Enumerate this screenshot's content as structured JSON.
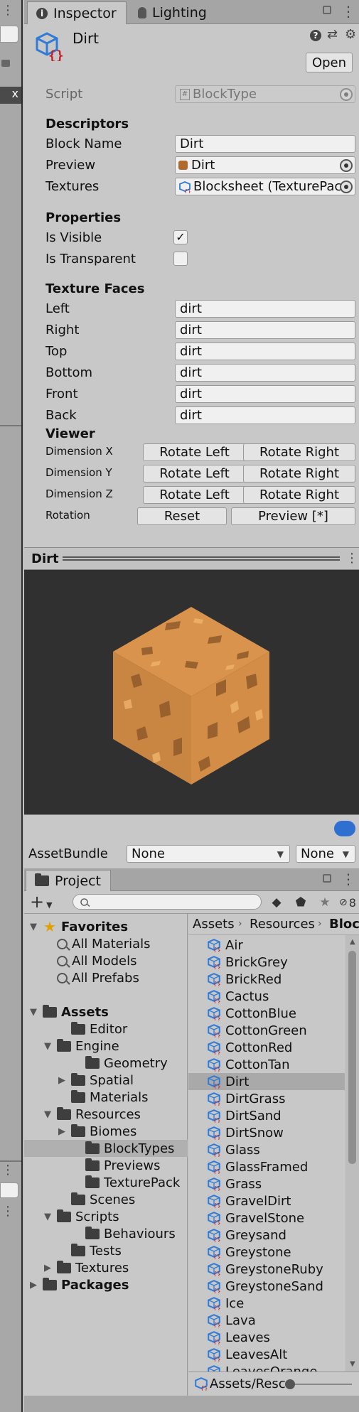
{
  "inspector": {
    "tabs": [
      {
        "label": "Inspector",
        "icon": "info-icon"
      },
      {
        "label": "Lighting",
        "icon": "bulb-icon"
      }
    ],
    "object_name": "Dirt",
    "open_label": "Open",
    "script_label": "Script",
    "script_value": "BlockType",
    "descriptors_header": "Descriptors",
    "block_name_label": "Block Name",
    "block_name_value": "Dirt",
    "preview_label": "Preview",
    "preview_value": "Dirt",
    "textures_label": "Textures",
    "textures_value": "Blocksheet (TexturePac",
    "properties_header": "Properties",
    "is_visible_label": "Is Visible",
    "is_visible_checked": true,
    "is_visible_mark": "✓",
    "is_transparent_label": "Is Transparent",
    "is_transparent_checked": false,
    "texture_faces_header": "Texture Faces",
    "faces": [
      {
        "label": "Left",
        "value": "dirt"
      },
      {
        "label": "Right",
        "value": "dirt"
      },
      {
        "label": "Top",
        "value": "dirt"
      },
      {
        "label": "Bottom",
        "value": "dirt"
      },
      {
        "label": "Front",
        "value": "dirt"
      },
      {
        "label": "Back",
        "value": "dirt"
      }
    ],
    "viewer_header": "Viewer",
    "dims": [
      {
        "label": "Dimension X",
        "left": "Rotate Left",
        "right": "Rotate Right"
      },
      {
        "label": "Dimension Y",
        "left": "Rotate Left",
        "right": "Rotate Right"
      },
      {
        "label": "Dimension Z",
        "left": "Rotate Left",
        "right": "Rotate Right"
      }
    ],
    "rotation_label": "Rotation",
    "reset_label": "Reset",
    "preview_btn_label": "Preview [*]"
  },
  "preview_panel": {
    "title": "Dirt",
    "cube_color": "#d08a45",
    "bg_color": "#303030"
  },
  "assetbundle": {
    "label": "AssetBundle",
    "name_value": "None",
    "variant_value": "None"
  },
  "project": {
    "tab_label": "Project",
    "add_label": "+",
    "hidden_count": "8",
    "breadcrumb": [
      "Assets",
      "Resources",
      "Bloc"
    ],
    "footer_path": "Assets/Resc",
    "tree": [
      {
        "label": "Favorites",
        "bold": true,
        "icon": "star-icon",
        "indent": 0,
        "arrow": "open"
      },
      {
        "label": "All Materials",
        "icon": "search-icon",
        "indent": 1
      },
      {
        "label": "All Models",
        "icon": "search-icon",
        "indent": 1
      },
      {
        "label": "All Prefabs",
        "icon": "search-icon",
        "indent": 1
      },
      {
        "label": "",
        "icon": "none",
        "indent": 0
      },
      {
        "label": "Assets",
        "bold": true,
        "icon": "folder-open-icon",
        "indent": 0,
        "arrow": "open"
      },
      {
        "label": "Editor",
        "icon": "folder-icon",
        "indent": 2
      },
      {
        "label": "Engine",
        "icon": "folder-open-icon",
        "indent": 1,
        "arrow": "open"
      },
      {
        "label": "Geometry",
        "icon": "folder-icon",
        "indent": 3
      },
      {
        "label": "Spatial",
        "icon": "folder-icon",
        "indent": 2,
        "arrow": "closed"
      },
      {
        "label": "Materials",
        "icon": "folder-icon",
        "indent": 2
      },
      {
        "label": "Resources",
        "icon": "folder-open-icon",
        "indent": 1,
        "arrow": "open"
      },
      {
        "label": "Biomes",
        "icon": "folder-icon",
        "indent": 2,
        "arrow": "closed"
      },
      {
        "label": "BlockTypes",
        "icon": "folder-icon",
        "indent": 3,
        "selected": true
      },
      {
        "label": "Previews",
        "icon": "folder-icon",
        "indent": 3
      },
      {
        "label": "TexturePack",
        "icon": "folder-icon",
        "indent": 3
      },
      {
        "label": "Scenes",
        "icon": "folder-icon",
        "indent": 2
      },
      {
        "label": "Scripts",
        "icon": "folder-open-icon",
        "indent": 1,
        "arrow": "open"
      },
      {
        "label": "Behaviours",
        "icon": "folder-icon",
        "indent": 3
      },
      {
        "label": "Tests",
        "icon": "folder-icon",
        "indent": 2
      },
      {
        "label": "Textures",
        "icon": "folder-icon",
        "indent": 1,
        "arrow": "closed"
      },
      {
        "label": "Packages",
        "bold": true,
        "icon": "folder-icon",
        "indent": 0,
        "arrow": "closed"
      }
    ],
    "assets": [
      "Air",
      "BrickGrey",
      "BrickRed",
      "Cactus",
      "CottonBlue",
      "CottonGreen",
      "CottonRed",
      "CottonTan",
      "Dirt",
      "DirtGrass",
      "DirtSand",
      "DirtSnow",
      "Glass",
      "GlassFramed",
      "Grass",
      "GravelDirt",
      "GravelStone",
      "Greysand",
      "Greystone",
      "GreystoneRuby",
      "GreystoneSand",
      "Ice",
      "Lava",
      "Leaves",
      "LeavesAlt",
      "LeavesOrange"
    ],
    "selected_asset": "Dirt"
  },
  "left_strip": {
    "close_glyph": "x"
  }
}
